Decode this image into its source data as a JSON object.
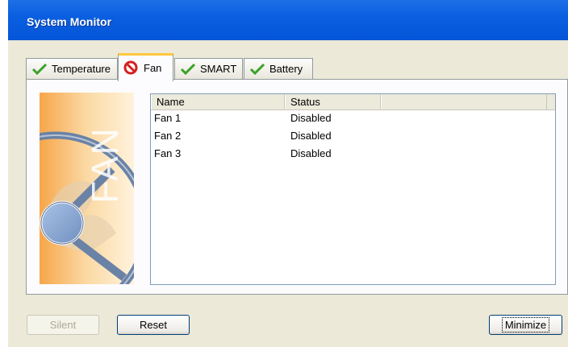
{
  "window": {
    "title": "System Monitor"
  },
  "tabs": [
    {
      "label": "Temperature",
      "icon": "checkmark-icon",
      "active": false
    },
    {
      "label": "Fan",
      "icon": "prohibited-icon",
      "active": true
    },
    {
      "label": "SMART",
      "icon": "checkmark-icon",
      "active": false
    },
    {
      "label": "Battery",
      "icon": "checkmark-icon",
      "active": false
    }
  ],
  "art": {
    "text": "FAN",
    "icon": "fan-illustration"
  },
  "table": {
    "columns": [
      "Name",
      "Status",
      ""
    ],
    "rows": [
      {
        "name": "Fan 1",
        "status": "Disabled"
      },
      {
        "name": "Fan 2",
        "status": "Disabled"
      },
      {
        "name": "Fan 3",
        "status": "Disabled"
      }
    ]
  },
  "buttons": {
    "silent": "Silent",
    "reset": "Reset",
    "minimize": "Minimize"
  },
  "colors": {
    "titlebar": "#0555d8",
    "active_tab_accent": "#ffc83d",
    "check_green": "#3aa22a",
    "stop_red": "#d42020"
  }
}
